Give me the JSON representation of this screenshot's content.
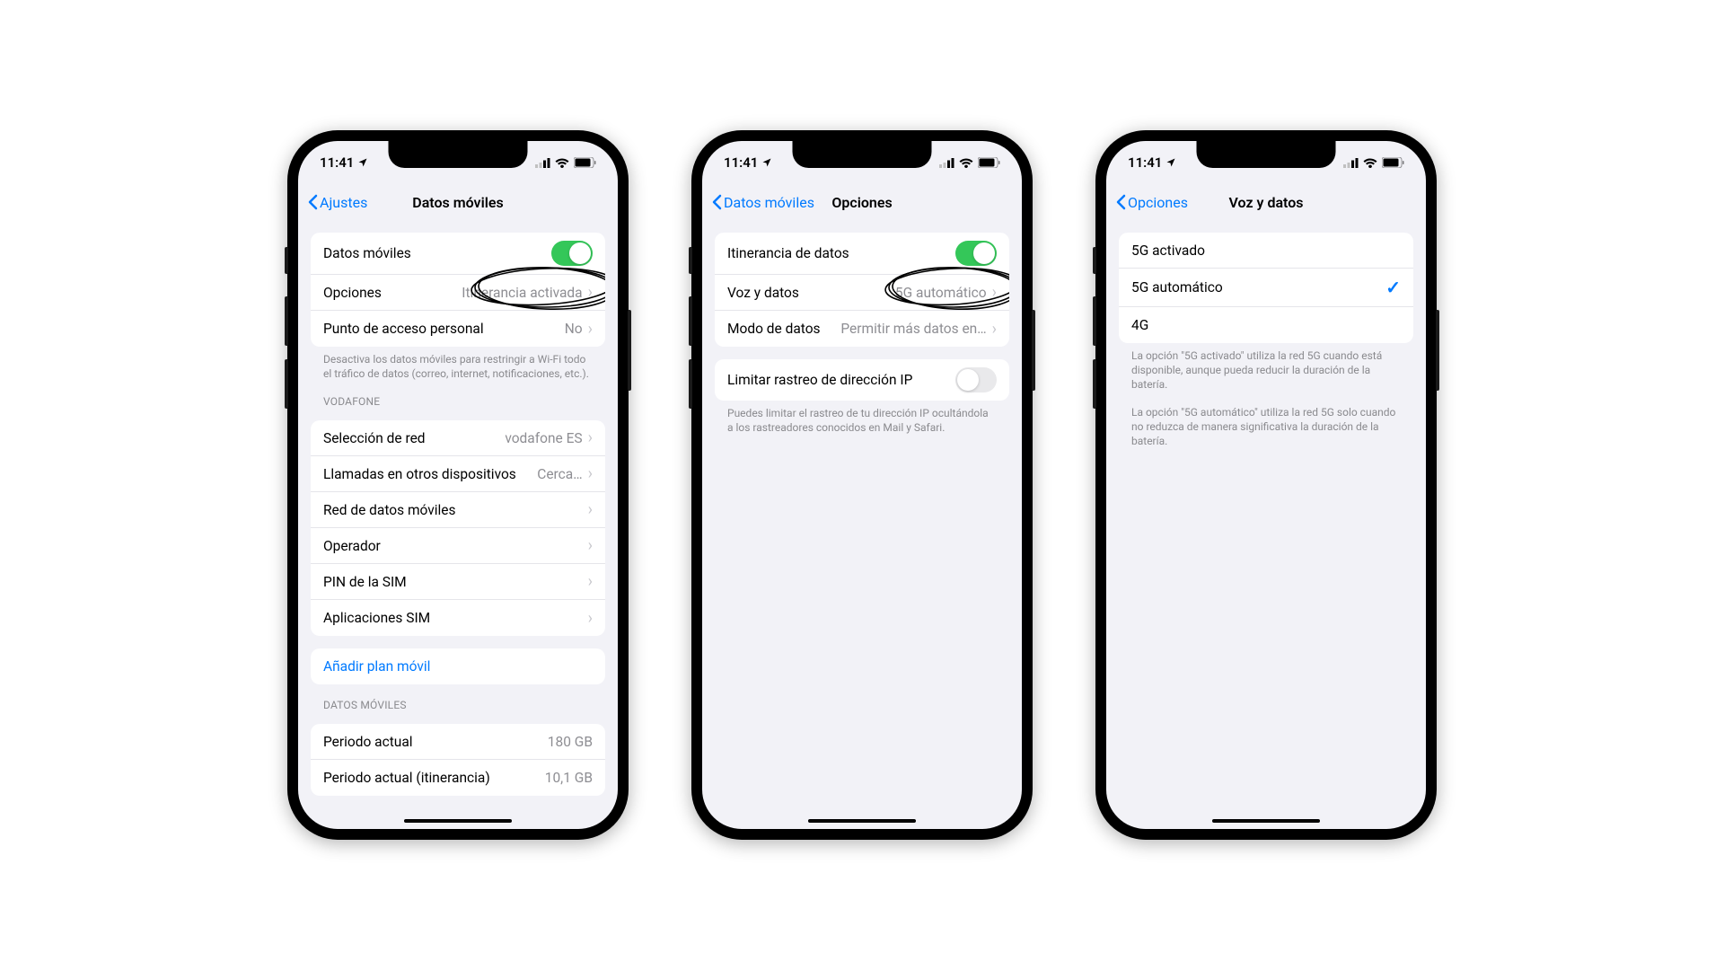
{
  "status": {
    "time": "11:41"
  },
  "phone1": {
    "back": "Ajustes",
    "title": "Datos móviles",
    "g1": {
      "datos_moviles": "Datos móviles",
      "opciones": "Opciones",
      "opciones_val": "Itinerancia activada",
      "punto_acceso": "Punto de acceso personal",
      "punto_acceso_val": "No"
    },
    "g1_footer": "Desactiva los datos móviles para restringir a Wi-Fi todo el tráfico de datos (correo, internet, notificaciones, etc.).",
    "sec_vodafone": "VODAFONE",
    "g2": {
      "seleccion_red": "Selección de red",
      "seleccion_red_val": "vodafone ES",
      "llamadas": "Llamadas en otros dispositivos",
      "llamadas_val": "Cerca…",
      "red_datos": "Red de datos móviles",
      "operador": "Operador",
      "pin_sim": "PIN de la SIM",
      "apps_sim": "Aplicaciones SIM"
    },
    "g3": {
      "anadir": "Añadir plan móvil"
    },
    "sec_datos": "DATOS MÓVILES",
    "g4": {
      "periodo_actual": "Periodo actual",
      "periodo_actual_val": "180 GB",
      "periodo_itin": "Periodo actual (itinerancia)",
      "periodo_itin_val": "10,1 GB"
    }
  },
  "phone2": {
    "back": "Datos móviles",
    "title": "Opciones",
    "g1": {
      "itinerancia": "Itinerancia de datos",
      "voz_datos": "Voz y datos",
      "voz_datos_val": "5G automático",
      "modo_datos": "Modo de datos",
      "modo_datos_val": "Permitir más datos en…"
    },
    "g2": {
      "limitar": "Limitar rastreo de dirección IP"
    },
    "g2_footer": "Puedes limitar el rastreo de tu dirección IP ocultándola a los rastreadores conocidos en Mail y Safari."
  },
  "phone3": {
    "back": "Opciones",
    "title": "Voz y datos",
    "opts": {
      "o1": "5G activado",
      "o2": "5G automático",
      "o3": "4G"
    },
    "footer1": "La opción \"5G activado\" utiliza la red 5G cuando está disponible, aunque pueda reducir la duración de la batería.",
    "footer2": "La opción \"5G automático\" utiliza la red 5G solo cuando no reduzca de manera significativa la duración de la batería."
  }
}
